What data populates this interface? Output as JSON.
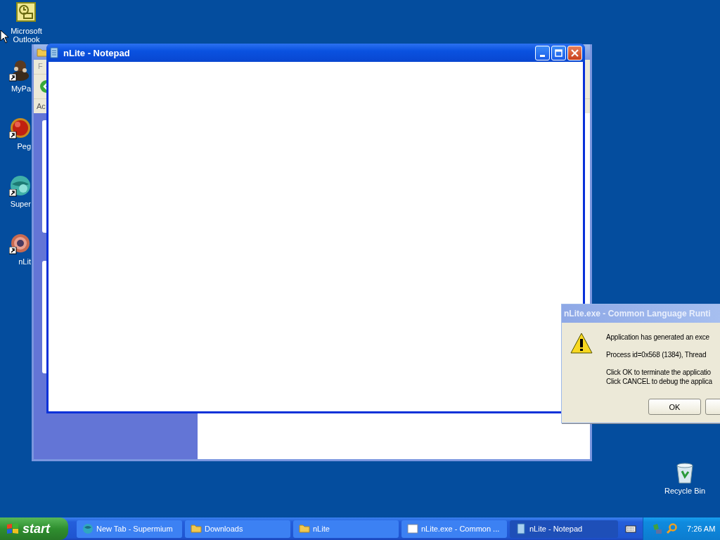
{
  "desktop_icons": [
    {
      "kind": "outlook",
      "label": "Microsoft Outlook",
      "shortcut": false
    },
    {
      "kind": "figure",
      "label": "MyPa",
      "shortcut": true
    },
    {
      "kind": "ball",
      "label": "Peg",
      "shortcut": true
    },
    {
      "kind": "sphere",
      "label": "Super",
      "shortcut": true
    },
    {
      "kind": "gear",
      "label": "nLit",
      "shortcut": true
    }
  ],
  "recycle_bin": {
    "label": "Recycle Bin"
  },
  "explorer_window": {
    "menu_fragment": "F",
    "address_fragment": "Ac"
  },
  "notepad_window": {
    "title": "nLite - Notepad",
    "active": true
  },
  "error_dialog": {
    "title": "nLite.exe - Common Language Runti",
    "lines": [
      "Application has generated an exce",
      "Process id=0x568 (1384), Thread",
      "Click OK to terminate the applicatio",
      "Click CANCEL to debug the applica"
    ],
    "ok_button": "OK"
  },
  "taskbar": {
    "start": "start",
    "tasks": [
      {
        "kind": "globe",
        "label": "New Tab - Supermium",
        "selected": false
      },
      {
        "kind": "folder",
        "label": "Downloads",
        "selected": false
      },
      {
        "kind": "folder",
        "label": "nLite",
        "selected": false
      },
      {
        "kind": "dialog",
        "label": "nLite.exe - Common ...",
        "selected": false
      },
      {
        "kind": "notepad",
        "label": "nLite - Notepad",
        "selected": true
      }
    ],
    "clock": "7:26 AM"
  }
}
